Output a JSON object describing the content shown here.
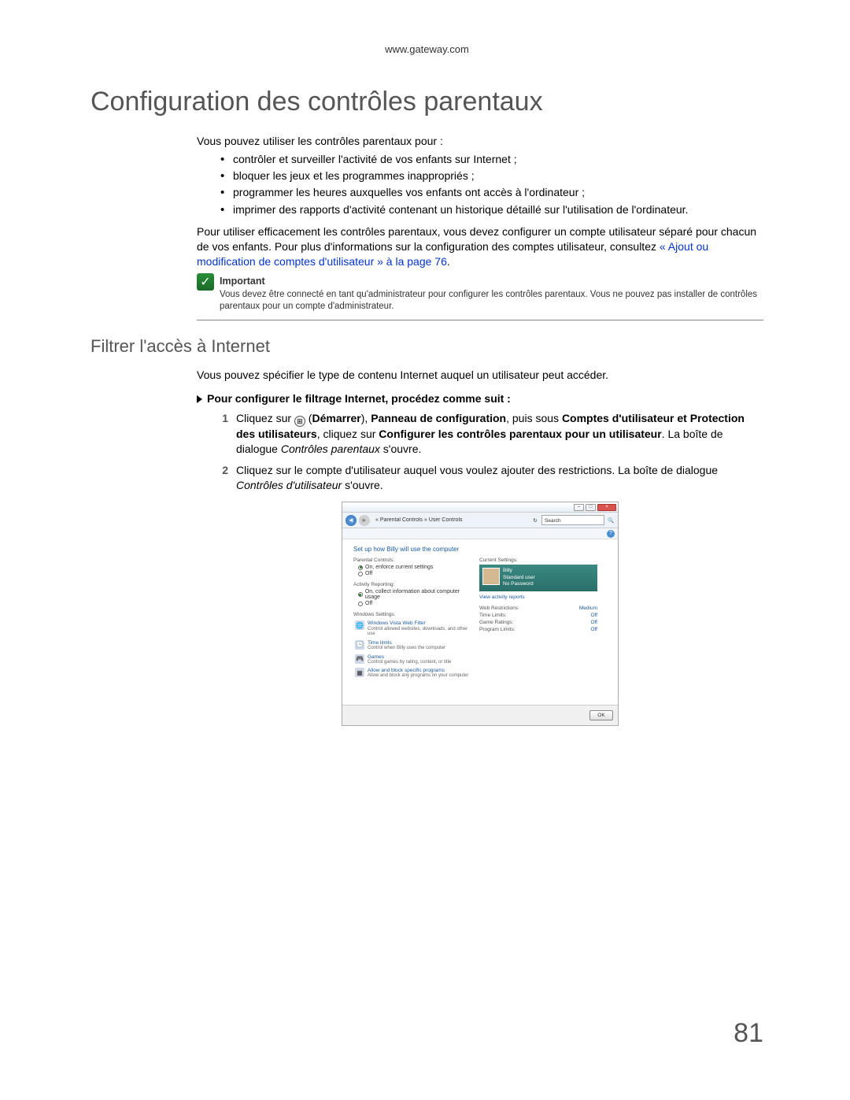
{
  "header_url": "www.gateway.com",
  "h1": "Configuration des contrôles parentaux",
  "intro": "Vous pouvez utiliser les contrôles parentaux pour :",
  "bullets": [
    "contrôler et surveiller l'activité de vos enfants sur Internet ;",
    "bloquer les jeux et les programmes inappropriés ;",
    "programmer les heures auxquelles vos enfants ont accès à l'ordinateur ;",
    "imprimer des rapports d'activité contenant un historique détaillé sur l'utilisation de l'ordinateur."
  ],
  "para2_a": "Pour utiliser efficacement les contrôles parentaux, vous devez configurer un compte utilisateur séparé pour chacun de vos enfants. Pour plus d'informations sur la configuration des comptes utilisateur, consultez ",
  "para2_link": "« Ajout ou modification de comptes d'utilisateur » à la page 76",
  "para2_c": ".",
  "important_title": "Important",
  "important_text": "Vous devez être connecté en tant qu'administrateur pour configurer les contrôles parentaux. Vous ne pouvez pas installer de contrôles parentaux pour un compte d'administrateur.",
  "h2": "Filtrer l'accès à Internet",
  "h2_intro": "Vous pouvez spécifier le type de contenu Internet auquel un utilisateur peut accéder.",
  "proc_title": "Pour configurer le filtrage Internet, procédez comme suit :",
  "step1": {
    "num": "1",
    "a": "Cliquez sur ",
    "start_label": "Démarrer",
    "b": "), ",
    "c": "Panneau de configuration",
    "d": ", puis sous ",
    "e": "Comptes d'utilisateur et Protection des utilisateurs",
    "f": ", cliquez sur ",
    "g": "Configurer les contrôles parentaux pour un utilisateur",
    "h": ". La boîte de dialogue ",
    "i": "Contrôles parentaux",
    "j": " s'ouvre."
  },
  "step2": {
    "num": "2",
    "a": "Cliquez sur le compte d'utilisateur auquel vous voulez ajouter des restrictions. La boîte de dialogue ",
    "b": "Contrôles d'utilisateur",
    "c": " s'ouvre."
  },
  "screenshot": {
    "breadcrumb": "« Parental Controls » User Controls",
    "search_placeholder": "Search",
    "title": "Set up how Billy will use the computer",
    "section_pc": "Parental Controls:",
    "pc_on": "On, enforce current settings",
    "pc_off": "Off",
    "section_ar": "Activity Reporting:",
    "ar_on": "On, collect information about computer usage",
    "ar_off": "Off",
    "section_ws": "Windows Settings:",
    "entry_web_t": "Windows Vista Web Filter",
    "entry_web_d": "Control allowed websites, downloads, and other use",
    "entry_time_t": "Time limits",
    "entry_time_d": "Control when Billy uses the computer",
    "entry_games_t": "Games",
    "entry_games_d": "Control games by rating, content, or title",
    "entry_prog_t": "Allow and block specific programs",
    "entry_prog_d": "Allow and block any programs on your computer",
    "rc_title": "Current Settings:",
    "user_name": "Billy",
    "user_type": "Standard user",
    "user_pw": "No Password",
    "view_reports": "View activity reports",
    "rows": [
      {
        "k": "Web Restrictions:",
        "v": "Medium"
      },
      {
        "k": "Time Limits:",
        "v": "Off"
      },
      {
        "k": "Game Ratings:",
        "v": "Off"
      },
      {
        "k": "Program Limits:",
        "v": "Off"
      }
    ],
    "ok": "OK"
  },
  "page_number": "81"
}
